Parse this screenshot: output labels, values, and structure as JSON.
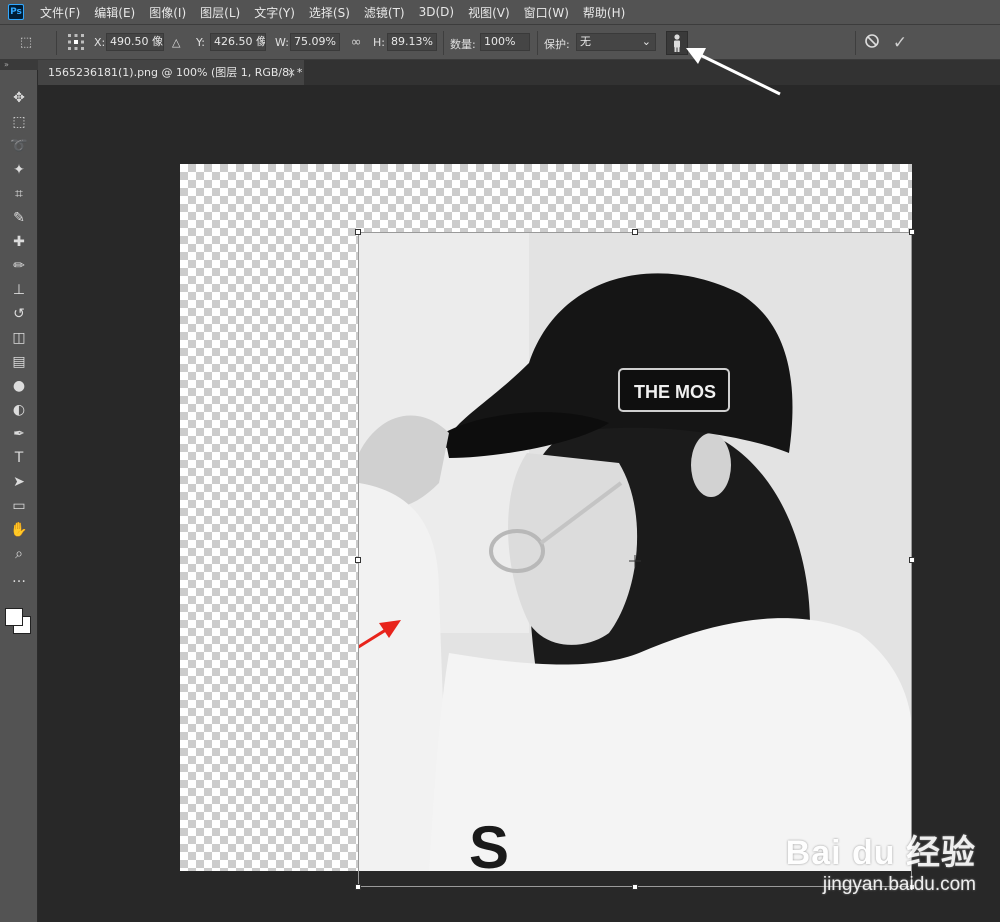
{
  "app": {
    "logo": "Ps"
  },
  "menu": [
    "文件(F)",
    "编辑(E)",
    "图像(I)",
    "图层(L)",
    "文字(Y)",
    "选择(S)",
    "滤镜(T)",
    "3D(D)",
    "视图(V)",
    "窗口(W)",
    "帮助(H)"
  ],
  "options": {
    "x_label": "X:",
    "x_value": "490.50 像素",
    "delta_icon": "△",
    "y_label": "Y:",
    "y_value": "426.50 像素",
    "w_label": "W:",
    "w_value": "75.09%",
    "h_label": "H:",
    "h_value": "89.13%",
    "density_label": "数量:",
    "density_value": "100%",
    "protect_label": "保护:",
    "protect_value": "无",
    "cancel_icon": "⃠",
    "commit_icon": "✓"
  },
  "document": {
    "tab_title": "1565236181(1).png @ 100% (图层 1, RGB/8) *",
    "tab_close": "×"
  },
  "photo": {
    "cap_text": "THE MOS",
    "hoodie_text": "S"
  },
  "watermark": {
    "main": "Bai du 经验",
    "sub": "jingyan.baidu.com"
  },
  "colors": {
    "chrome": "#535353",
    "workspace": "#282828",
    "arrow_red": "#e8241c",
    "arrow_white": "#ffffff"
  },
  "tools": [
    "move-icon",
    "marquee-icon",
    "lasso-icon",
    "magic-wand-icon",
    "crop-icon",
    "eyedropper-icon",
    "healing-brush-icon",
    "brush-icon",
    "clone-stamp-icon",
    "history-brush-icon",
    "eraser-icon",
    "gradient-icon",
    "blur-icon",
    "dodge-icon",
    "pen-icon",
    "type-icon",
    "path-selection-icon",
    "rectangle-icon",
    "hand-icon",
    "zoom-icon",
    "more-icon"
  ]
}
